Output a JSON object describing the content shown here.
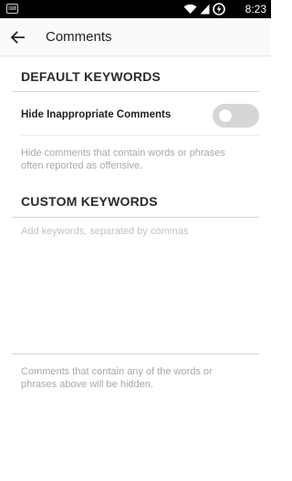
{
  "status_bar": {
    "time": "8:23",
    "notification_icon": "keyboard-notification-icon",
    "icons": [
      "wifi-icon",
      "signal-icon",
      "battery-charging-icon"
    ]
  },
  "app_bar": {
    "back_icon": "arrow-back-icon",
    "title": "Comments"
  },
  "default_keywords": {
    "header": "DEFAULT KEYWORDS",
    "toggle_label": "Hide Inappropriate Comments",
    "toggle_on": false,
    "description": "Hide comments that contain words or phrases often reported as offensive."
  },
  "custom_keywords": {
    "header": "CUSTOM KEYWORDS",
    "input_value": "",
    "input_placeholder": "Add keywords, separated by commas",
    "footer_text": "Comments that contain any of the words or phrases above will be hidden."
  },
  "colors": {
    "text_primary": "#222222",
    "text_hint": "#a9a9a9",
    "divider": "#d6d6d6",
    "toggle_off": "#d6d6d6"
  }
}
